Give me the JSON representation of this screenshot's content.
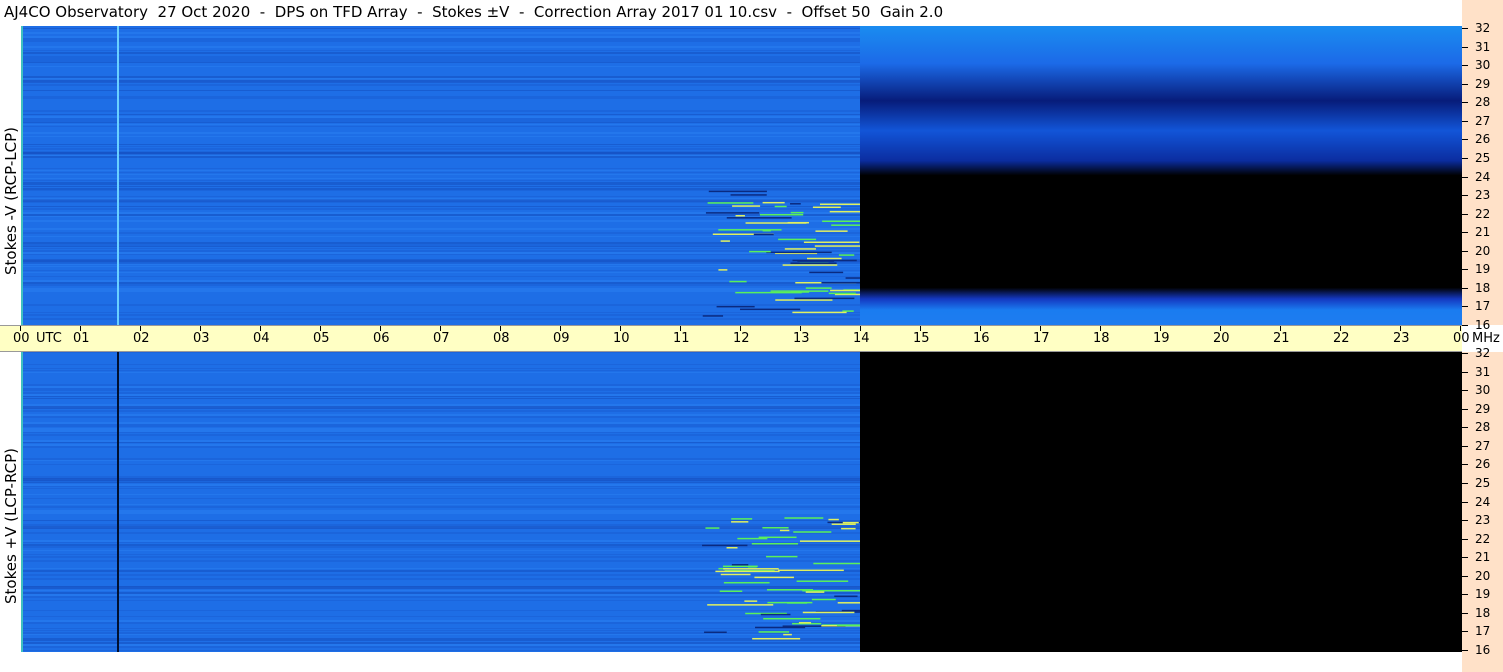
{
  "title": "AJ4CO Observatory  27 Oct 2020  -  DPS on TFD Array  -  Stokes ±V  -  Correction Array 2017 01 10.csv  -  Offset 50  Gain 2.0",
  "colors": {
    "time_bar": "#ffffc4",
    "freq_bar": "#ffe1c8",
    "spectrogram_base": "#1e6ee6",
    "no_data": "#000000",
    "rfi_green": "#5af05a"
  },
  "chart_data": [
    {
      "type": "heatmap",
      "name": "Stokes -V (RCP-LCP)",
      "ylabel": "Stokes -V (RCP-LCP)",
      "x_ticks": [
        "00",
        "01",
        "02",
        "03",
        "04",
        "05",
        "06",
        "07",
        "08",
        "09",
        "10",
        "11",
        "12",
        "13",
        "14",
        "15",
        "16",
        "17",
        "18",
        "19",
        "20",
        "21",
        "22",
        "23",
        "00"
      ],
      "x_unit": "UTC",
      "y_ticks": [
        32,
        31,
        30,
        29,
        28,
        27,
        26,
        25,
        24,
        23,
        22,
        21,
        20,
        19,
        18,
        17,
        16
      ],
      "y_unit": "MHz",
      "xlim": [
        0,
        24
      ],
      "ylim": [
        16,
        32
      ],
      "data_end_utc": 14,
      "bands_after_data": [
        {
          "from_mhz": 24,
          "to_mhz": 32,
          "fill": "blue_gradient"
        },
        {
          "from_mhz": 18,
          "to_mhz": 24,
          "fill": "black"
        },
        {
          "from_mhz": 16,
          "to_mhz": 18,
          "fill": "blue_gradient"
        }
      ]
    },
    {
      "type": "heatmap",
      "name": "Stokes +V (LCP-RCP)",
      "ylabel": "Stokes +V (LCP-RCP)",
      "x_ticks": [
        "00",
        "01",
        "02",
        "03",
        "04",
        "05",
        "06",
        "07",
        "08",
        "09",
        "10",
        "11",
        "12",
        "13",
        "14",
        "15",
        "16",
        "17",
        "18",
        "19",
        "20",
        "21",
        "22",
        "23",
        "00"
      ],
      "x_unit": "UTC",
      "y_ticks": [
        32,
        31,
        30,
        29,
        28,
        27,
        26,
        25,
        24,
        23,
        22,
        21,
        20,
        19,
        18,
        17,
        16
      ],
      "y_unit": "MHz",
      "xlim": [
        0,
        24
      ],
      "ylim": [
        16,
        32
      ],
      "data_end_utc": 14,
      "bands_after_data": [
        {
          "from_mhz": 16,
          "to_mhz": 32,
          "fill": "black"
        }
      ]
    }
  ],
  "time_axis": {
    "labels": [
      "00",
      "01",
      "02",
      "03",
      "04",
      "05",
      "06",
      "07",
      "08",
      "09",
      "10",
      "11",
      "12",
      "13",
      "14",
      "15",
      "16",
      "17",
      "18",
      "19",
      "20",
      "21",
      "22",
      "23",
      "00"
    ],
    "utc_label": "UTC",
    "mhz_label": "MHz"
  }
}
